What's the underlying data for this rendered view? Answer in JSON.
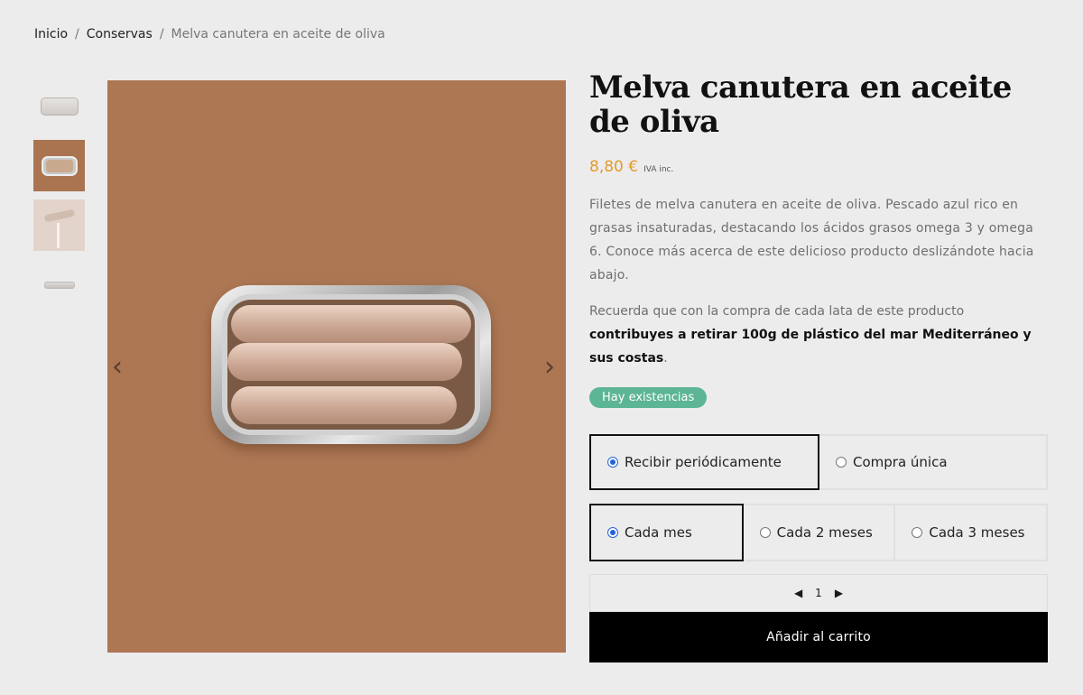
{
  "breadcrumb": {
    "home": "Inicio",
    "category": "Conservas",
    "current": "Melva canutera en aceite de oliva",
    "separator": "/"
  },
  "product": {
    "title": "Melva canutera en aceite de oliva",
    "price": "8,80 €",
    "tax_note": "IVA inc.",
    "description": "Filetes de melva canutera en aceite de oliva. Pescado azul rico en grasas insaturadas, destacando los ácidos grasos omega 3 y omega 6. Conoce más acerca de este delicioso producto deslizándote hacia abajo.",
    "impact_prefix": "Recuerda que con la compra de cada lata de este producto ",
    "impact_bold": "contribuyes a retirar 100g de plástico del mar Mediterráneo y sus costas",
    "impact_suffix": ".",
    "stock_badge": "Hay existencias",
    "colors": {
      "price": "#e39b2d",
      "badge": "#5cb594",
      "image_bg": "#ad7754"
    }
  },
  "gallery": {
    "prev_arrow": "‹",
    "next_arrow": "›",
    "thumbnail_count": 4
  },
  "purchase": {
    "mode_options": [
      {
        "label": "Recibir periódicamente",
        "selected": true
      },
      {
        "label": "Compra única",
        "selected": false
      }
    ],
    "frequency_options": [
      {
        "label": "Cada mes",
        "selected": true
      },
      {
        "label": "Cada 2 meses",
        "selected": false
      },
      {
        "label": "Cada 3 meses",
        "selected": false
      }
    ],
    "quantity": "1",
    "decrease": "◀",
    "increase": "▶",
    "add_to_cart": "Añadir al carrito"
  }
}
